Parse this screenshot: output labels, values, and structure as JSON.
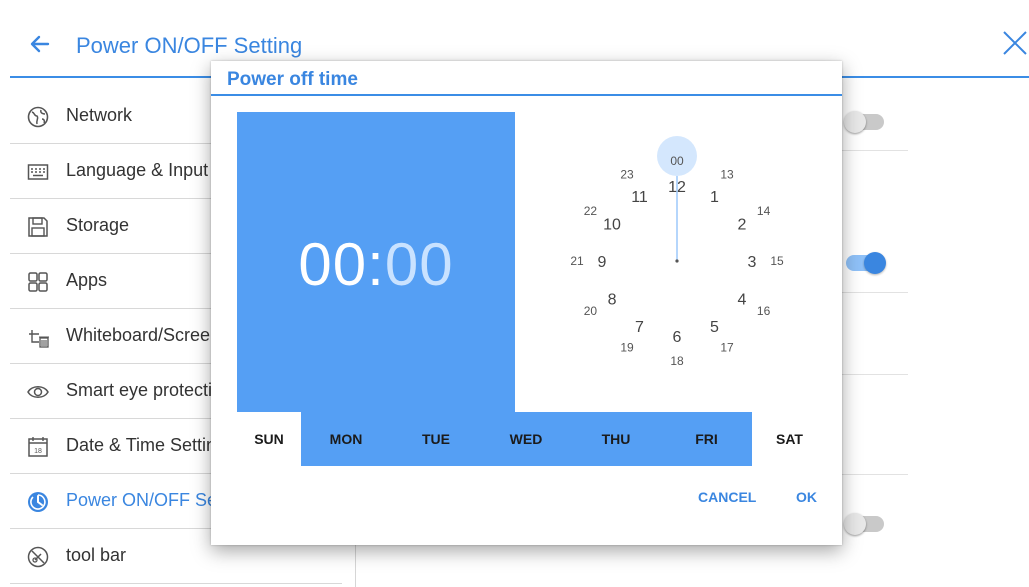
{
  "header": {
    "title": "Power ON/OFF Setting",
    "back_icon": "arrow-left-icon",
    "close_icon": "close-icon",
    "accent": "#3a86e0"
  },
  "sidebar": {
    "items": [
      {
        "label": "Network",
        "icon": "globe-icon"
      },
      {
        "label": "Language & Input",
        "icon": "keyboard-icon"
      },
      {
        "label": "Storage",
        "icon": "save-icon"
      },
      {
        "label": "Apps",
        "icon": "apps-grid-icon"
      },
      {
        "label": "Whiteboard/Screen",
        "icon": "whiteboard-icon"
      },
      {
        "label": "Smart eye protection",
        "icon": "eye-icon"
      },
      {
        "label": "Date & Time Settings",
        "icon": "calendar-icon"
      },
      {
        "label": "Power ON/OFF Setting",
        "icon": "power-timer-icon",
        "active": true
      },
      {
        "label": "tool bar",
        "icon": "toolbar-icon"
      }
    ]
  },
  "settings": {
    "toggles": [
      {
        "on": false
      },
      {
        "on": true
      },
      {
        "on": false
      }
    ]
  },
  "dialog": {
    "title": "Power off time",
    "hour": "00",
    "separator": ":",
    "minute": "00",
    "clock": {
      "outer_hours": [
        "12",
        "1",
        "2",
        "3",
        "4",
        "5",
        "6",
        "7",
        "8",
        "9",
        "10",
        "11"
      ],
      "inner_hours": [
        "00",
        "13",
        "14",
        "15",
        "16",
        "17",
        "18",
        "19",
        "20",
        "21",
        "22",
        "23"
      ],
      "selected": "00"
    },
    "days": [
      {
        "label": "SUN",
        "selected": false
      },
      {
        "label": "MON",
        "selected": true
      },
      {
        "label": "TUE",
        "selected": true
      },
      {
        "label": "WED",
        "selected": true
      },
      {
        "label": "THU",
        "selected": true
      },
      {
        "label": "FRI",
        "selected": true
      },
      {
        "label": "SAT",
        "selected": false
      }
    ],
    "cancel_label": "CANCEL",
    "ok_label": "OK"
  }
}
